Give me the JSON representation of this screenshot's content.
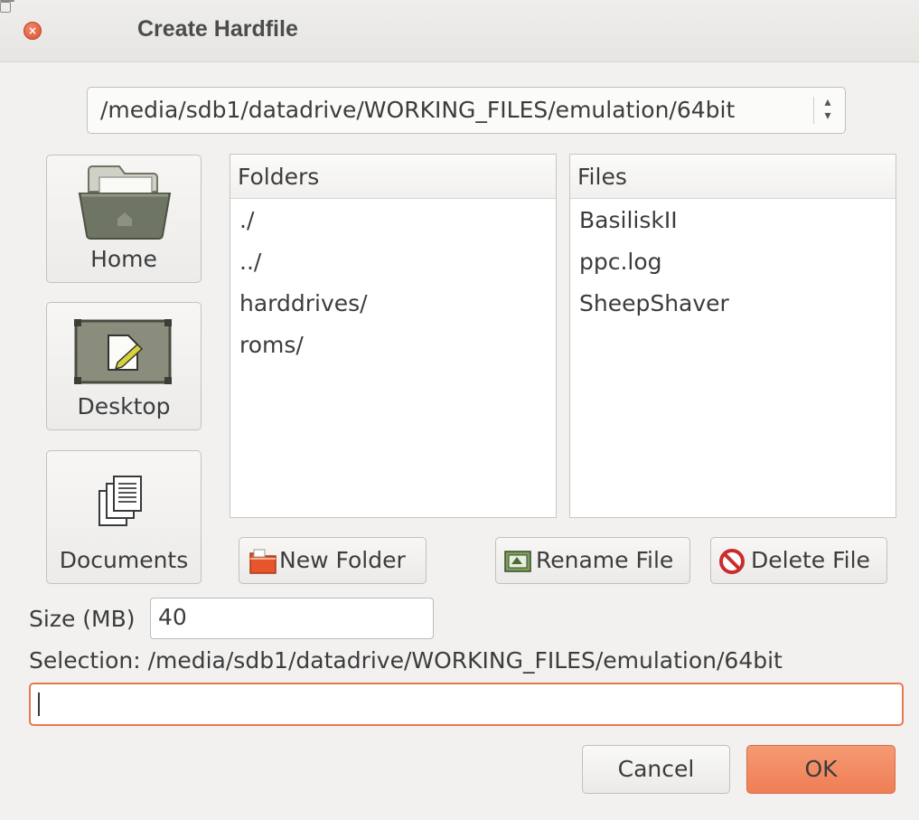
{
  "window": {
    "title": "Create Hardfile"
  },
  "path_combo": {
    "value": "/media/sdb1/datadrive/WORKING_FILES/emulation/64bit"
  },
  "places": [
    {
      "label": "Home",
      "icon": "home-folder-icon"
    },
    {
      "label": "Desktop",
      "icon": "desktop-icon"
    },
    {
      "label": "Documents",
      "icon": "documents-icon"
    }
  ],
  "folders": {
    "header": "Folders",
    "items": [
      "./",
      "../",
      "harddrives/",
      "roms/"
    ]
  },
  "files": {
    "header": "Files",
    "items": [
      "BasiliskII",
      "ppc.log",
      "SheepShaver"
    ]
  },
  "actions": {
    "new_folder": "New Folder",
    "rename_file": "Rename File",
    "delete_file": "Delete File"
  },
  "size": {
    "label": "Size (MB)",
    "value": "40"
  },
  "selection": {
    "label": "Selection: /media/sdb1/datadrive/WORKING_FILES/emulation/64bit",
    "value": ""
  },
  "buttons": {
    "cancel": "Cancel",
    "ok": "OK"
  },
  "colors": {
    "accent": "#ef7e55",
    "focus_border": "#e8794f",
    "background": "#f2f1f0"
  }
}
